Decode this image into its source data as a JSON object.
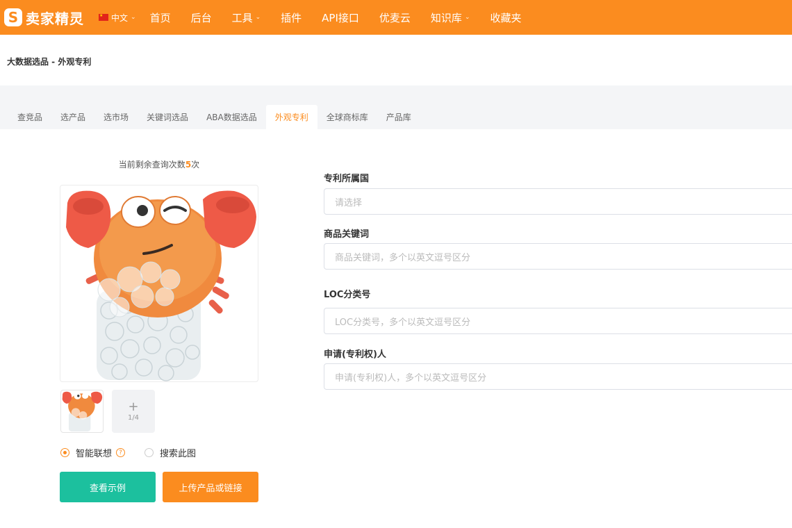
{
  "brand": {
    "logo_letter": "S",
    "name": "卖家精灵"
  },
  "language": "中文",
  "nav": [
    {
      "label": "首页",
      "dropdown": false
    },
    {
      "label": "后台",
      "dropdown": false
    },
    {
      "label": "工具",
      "dropdown": true
    },
    {
      "label": "插件",
      "dropdown": false
    },
    {
      "label": "API接口",
      "dropdown": false
    },
    {
      "label": "优麦云",
      "dropdown": false
    },
    {
      "label": "知识库",
      "dropdown": true
    },
    {
      "label": "收藏夹",
      "dropdown": false
    }
  ],
  "breadcrumb": "大数据选品 - 外观专利",
  "tabs": [
    "查竞品",
    "选产品",
    "选市场",
    "关键词选品",
    "ABA数据选品",
    "外观专利",
    "全球商标库",
    "产品库"
  ],
  "active_tab": "外观专利",
  "remaining": {
    "prefix": "当前剩余查询次数",
    "count": "5",
    "suffix": "次"
  },
  "thumb_count": "1/4",
  "search_modes": {
    "smart": "智能联想",
    "image": "搜索此图",
    "selected": "smart"
  },
  "buttons": {
    "example": "查看示例",
    "upload": "上传产品或链接"
  },
  "form": {
    "country": {
      "label": "专利所属国",
      "placeholder": "请选择"
    },
    "keyword": {
      "label": "商品关键词",
      "placeholder": "商品关键词，多个以英文逗号区分"
    },
    "loc": {
      "label": "LOC分类号",
      "placeholder": "LOC分类号，多个以英文逗号区分"
    },
    "applicant": {
      "label": "申请(专利权)人",
      "placeholder": "申请(专利权)人，多个以英文逗号区分"
    }
  },
  "colors": {
    "brand": "#fb8c1f",
    "teal": "#1cc09e"
  }
}
